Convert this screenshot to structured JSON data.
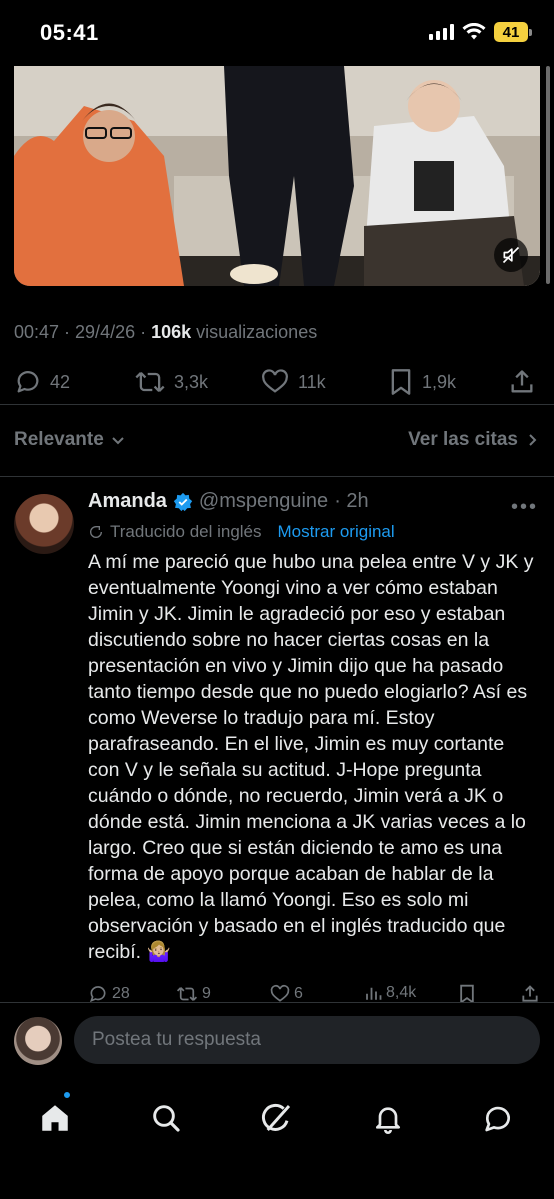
{
  "status_bar": {
    "time": "05:41",
    "battery": "41"
  },
  "tweet": {
    "timestamp": "00:47 · 29/4/26 · ",
    "views_count": "106k",
    "views_label": " visualizaciones",
    "replies": "42",
    "reposts": "3,3k",
    "likes": "11k",
    "bookmarks": "1,9k"
  },
  "sort": {
    "relevance_label": "Relevante",
    "quotes_label": "Ver las citas"
  },
  "reply": {
    "name": "Amanda",
    "handle": "@mspenguine",
    "time": "· 2h",
    "translated_label": "Traducido del inglés",
    "show_original": "Mostrar original",
    "text": "A mí me pareció que hubo una pelea entre V y JK y eventualmente Yoongi vino a ver cómo estaban Jimin y JK. Jimin le agradeció por eso y estaban discutiendo sobre no hacer ciertas cosas en la presentación en vivo y Jimin dijo que ha pasado tanto tiempo desde que no puedo elogiarlo? Así es como Weverse lo tradujo para mí. Estoy parafraseando. En el live, Jimin es muy cortante con V y le señala su actitud. J-Hope pregunta cuándo o dónde, no recuerdo, Jimin verá a JK o dónde está. Jimin menciona a JK varias veces a lo largo. Creo que si están diciendo te amo es una forma de apoyo porque acaban de hablar de la pelea, como la llamó Yoongi. Eso es solo mi observación y basado en el inglés traducido que recibí. 🤷🏼‍♀️",
    "replies": "28",
    "reposts": "9",
    "likes": "6",
    "views": "8,4k"
  },
  "compose": {
    "placeholder": "Postea tu respuesta"
  },
  "colors": {
    "accent": "#1d9bf0",
    "muted": "#71767b",
    "text": "#e7e9ea",
    "battery": "#f4d03f"
  },
  "icons": [
    "reply-icon",
    "repost-icon",
    "like-icon",
    "bookmark-icon",
    "share-icon",
    "verified-icon",
    "translate-icon",
    "views-icon",
    "home-icon",
    "search-icon",
    "grok-icon",
    "notifications-icon",
    "messages-icon",
    "mute-icon"
  ]
}
